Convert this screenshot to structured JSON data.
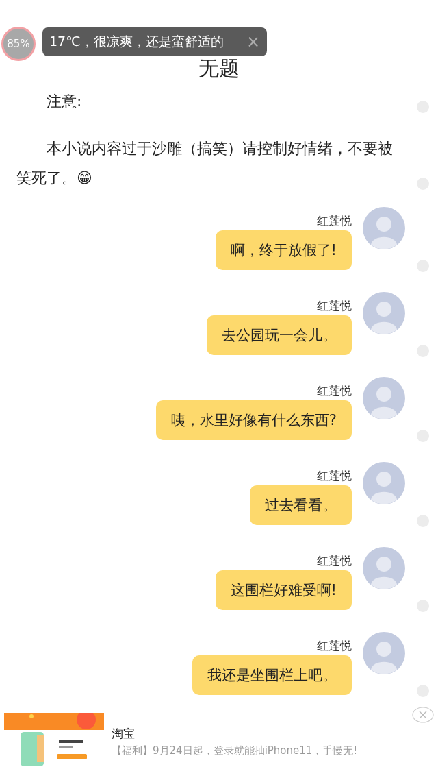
{
  "battery": {
    "reading": "85%"
  },
  "toast": {
    "text": "17℃，很凉爽，还是蛮舒适的",
    "close": "×"
  },
  "title": "无题",
  "paragraphs": [
    "注意:",
    "本小说内容过于沙雕（搞笑）请控制好情绪，不要被笑死了。😁"
  ],
  "messages": [
    {
      "sender": "红莲悦",
      "text": "啊，终于放假了!"
    },
    {
      "sender": "红莲悦",
      "text": "去公园玩一会儿。"
    },
    {
      "sender": "红莲悦",
      "text": "咦，水里好像有什么东西?"
    },
    {
      "sender": "红莲悦",
      "text": "过去看看。"
    },
    {
      "sender": "红莲悦",
      "text": "这围栏好难受啊!"
    },
    {
      "sender": "红莲悦",
      "text": "我还是坐围栏上吧。"
    }
  ],
  "ad": {
    "source": "淘宝",
    "text": "【福利】9月24日起，登录就能抽iPhone11，手慢无!"
  }
}
